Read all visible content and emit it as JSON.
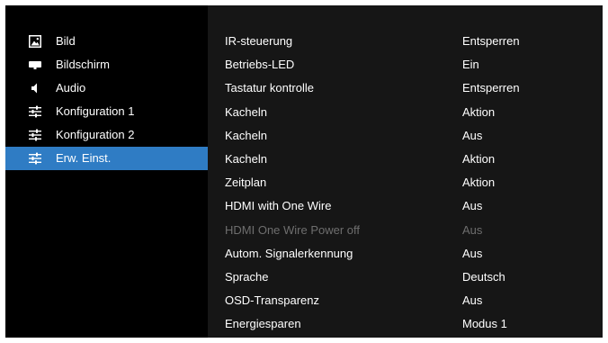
{
  "sidebar": {
    "items": [
      {
        "label": "Bild",
        "icon": "picture-icon",
        "active": false
      },
      {
        "label": "Bildschirm",
        "icon": "screen-icon",
        "active": false
      },
      {
        "label": "Audio",
        "icon": "speaker-icon",
        "active": false
      },
      {
        "label": "Konfiguration 1",
        "icon": "sliders-icon",
        "active": false
      },
      {
        "label": "Konfiguration 2",
        "icon": "sliders-icon",
        "active": false
      },
      {
        "label": "Erw. Einst.",
        "icon": "sliders-icon",
        "active": true
      }
    ]
  },
  "settings": {
    "rows": [
      {
        "name": "IR-steuerung",
        "value": "Entsperren",
        "enabled": true
      },
      {
        "name": "Betriebs-LED",
        "value": "Ein",
        "enabled": true
      },
      {
        "name": "Tastatur kontrolle",
        "value": "Entsperren",
        "enabled": true
      },
      {
        "name": "Kacheln",
        "value": "Aktion",
        "enabled": true
      },
      {
        "name": "Kacheln",
        "value": "Aus",
        "enabled": true
      },
      {
        "name": "Kacheln",
        "value": "Aktion",
        "enabled": true
      },
      {
        "name": "Zeitplan",
        "value": "Aktion",
        "enabled": true
      },
      {
        "name": "HDMI with One Wire",
        "value": "Aus",
        "enabled": true
      },
      {
        "name": "HDMI One Wire Power off",
        "value": "Aus",
        "enabled": false
      },
      {
        "name": "Autom. Signalerkennung",
        "value": "Aus",
        "enabled": true
      },
      {
        "name": "Sprache",
        "value": "Deutsch",
        "enabled": true
      },
      {
        "name": "OSD-Transparenz",
        "value": "Aus",
        "enabled": true
      },
      {
        "name": "Energiesparen",
        "value": "Modus 1",
        "enabled": true
      }
    ]
  },
  "colors": {
    "background": "#000000",
    "content_background": "#161616",
    "active_highlight": "#2f7cc4",
    "text": "#ffffff",
    "disabled_text": "#6e6e6e"
  }
}
